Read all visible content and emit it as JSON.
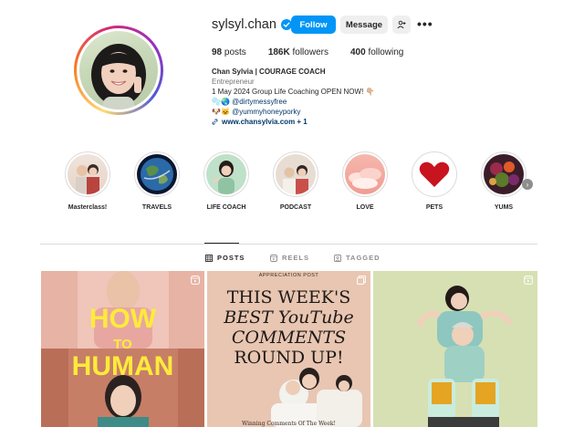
{
  "profile": {
    "username": "sylsyl.chan",
    "follow_label": "Follow",
    "message_label": "Message",
    "more_label": "•••",
    "stats": [
      {
        "value": "98",
        "label": "posts"
      },
      {
        "value": "186K",
        "label": "followers"
      },
      {
        "value": "400",
        "label": "following"
      }
    ],
    "bio": {
      "name": "Chan Sylvia | COURAGE COACH",
      "category": "Entrepreneur",
      "line1": "1 May 2024 Group Life Coaching OPEN NOW! 👇🏼",
      "line2_prefix": "🫧🌏",
      "line2_link": "@dirtymessyfree",
      "line3_prefix": "🐶🐱",
      "line3_link": "@yummyhoneyporky",
      "website": "www.chansylvia.com + 1"
    }
  },
  "highlights": [
    {
      "label": "Masterclass!"
    },
    {
      "label": "TRAVELS"
    },
    {
      "label": "LIFE COACH"
    },
    {
      "label": "PODCAST"
    },
    {
      "label": "LOVE"
    },
    {
      "label": "PETS"
    },
    {
      "label": "YUMS"
    }
  ],
  "tabs": {
    "posts": "POSTS",
    "reels": "REELS",
    "tagged": "TAGGED"
  },
  "posts": {
    "post1": {
      "line1": "HOW",
      "line2": "TO",
      "line3": "HUMAN"
    },
    "post2": {
      "kicker": "APPRECIATION POST",
      "head1": "THIS WEEK'S",
      "head2": "BEST YouTube",
      "head3": "COMMENTS",
      "head4": "ROUND UP!",
      "footer": "Winning Comments Of The Week!"
    }
  },
  "colors": {
    "follow": "#0095f6",
    "link": "#00376b",
    "how_to_human": "#ffeb3b"
  }
}
